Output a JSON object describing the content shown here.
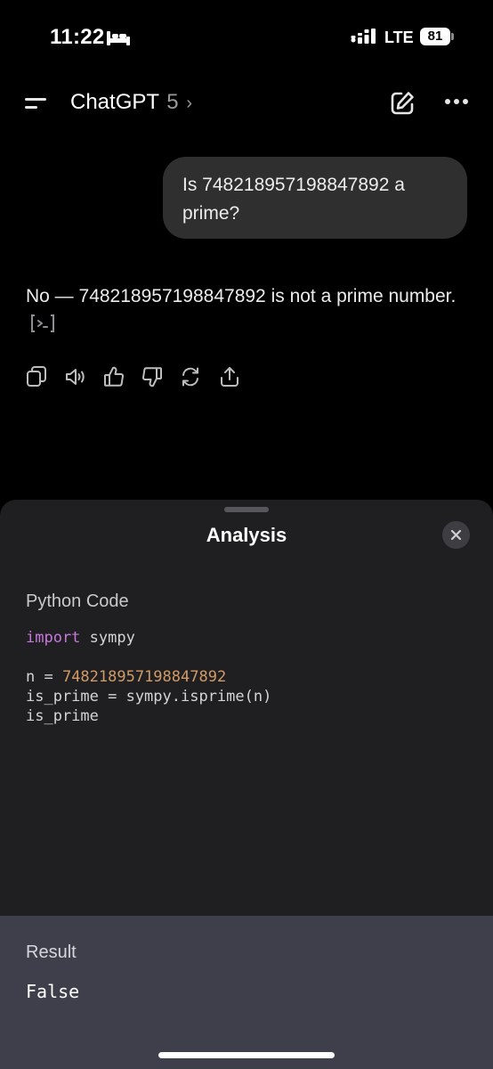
{
  "status_bar": {
    "time": "11:22",
    "network": "LTE",
    "battery": "81",
    "icons": [
      "bed-icon",
      "signal-icon",
      "battery-icon"
    ]
  },
  "header": {
    "title": "ChatGPT",
    "model": "5",
    "chevron": "›",
    "icons": [
      "menu-icon",
      "new-chat-icon",
      "more-icon"
    ]
  },
  "chat": {
    "user_message": "Is 748218957198847892 a prime?",
    "assistant_message": "No — 748218957198847892 is not a prime number.",
    "actions": [
      "copy-icon",
      "read-aloud-icon",
      "thumbs-up-icon",
      "thumbs-down-icon",
      "regenerate-icon",
      "share-icon"
    ]
  },
  "analysis_sheet": {
    "title": "Analysis",
    "code_label": "Python Code",
    "code": {
      "line1_keyword": "import",
      "line1_rest": " sympy",
      "line3_prefix": "n = ",
      "line3_number": "748218957198847892",
      "line4": "is_prime = sympy.isprime(n)",
      "line5": "is_prime"
    },
    "result_label": "Result",
    "result_value": "False"
  },
  "colors": {
    "background": "#000000",
    "bubble": "#2f2f2f",
    "sheet": "#1f1f22",
    "result_panel": "#3e3f4a",
    "keyword": "#c678dd",
    "number": "#d19a66"
  }
}
